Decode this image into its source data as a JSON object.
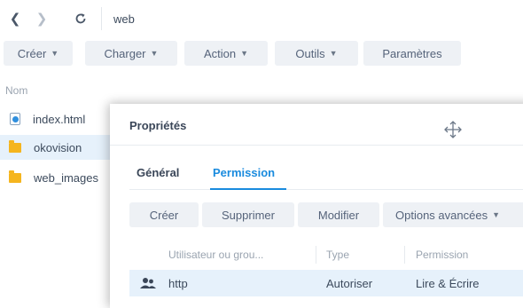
{
  "address_bar": {
    "back_icon": "chevron-left-icon",
    "forward_icon": "chevron-right-icon",
    "refresh_icon": "refresh-icon",
    "path": "web"
  },
  "toolbar": {
    "create": "Créer",
    "upload": "Charger",
    "action": "Action",
    "tools": "Outils",
    "settings": "Paramètres"
  },
  "file_list": {
    "column_name": "Nom",
    "items": [
      {
        "name": "index.html",
        "icon": "html-file-icon"
      },
      {
        "name": "okovision",
        "icon": "folder-icon"
      },
      {
        "name": "web_images",
        "icon": "folder-icon"
      }
    ]
  },
  "dialog": {
    "title": "Propriétés",
    "tabs": {
      "general": "Général",
      "permission": "Permission"
    },
    "buttons": {
      "create": "Créer",
      "delete": "Supprimer",
      "edit": "Modifier",
      "advanced": "Options avancées"
    },
    "table": {
      "headers": {
        "user": "Utilisateur ou grou...",
        "type": "Type",
        "permission": "Permission"
      },
      "rows": [
        {
          "user": "http",
          "type": "Autoriser",
          "permission": "Lire & Écrire"
        }
      ]
    }
  },
  "colors": {
    "accent": "#1a8bde",
    "folder": "#f5b51e",
    "button_bg": "#eef1f5",
    "selected_row": "#e6f1fb"
  }
}
